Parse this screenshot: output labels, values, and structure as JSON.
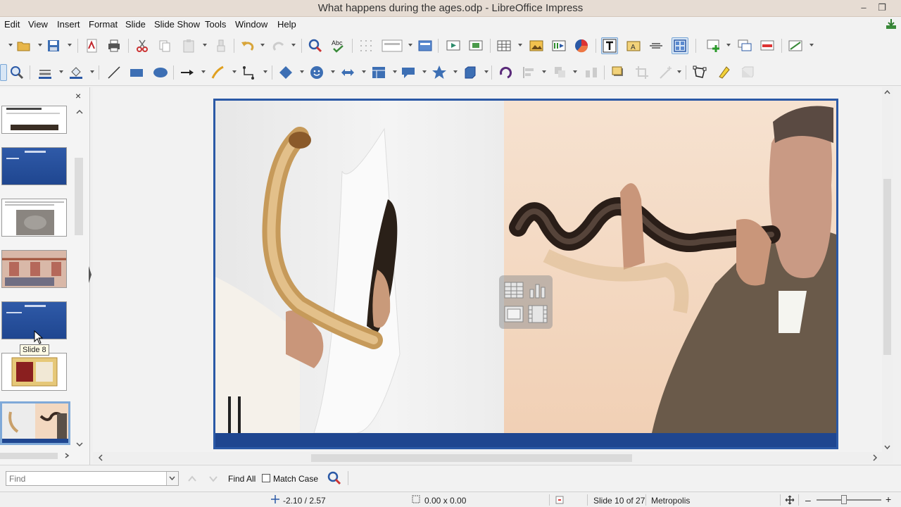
{
  "window": {
    "title": "What happens during the ages.odp - LibreOffice Impress",
    "minimize": "–",
    "restore": "❐"
  },
  "menu": [
    "Edit",
    "View",
    "Insert",
    "Format",
    "Slide",
    "Slide Show",
    "Tools",
    "Window",
    "Help"
  ],
  "slides_panel": {
    "close": "×",
    "tooltip": "Slide 8"
  },
  "findbar": {
    "placeholder": "Find",
    "find_all": "Find All",
    "match_case": "Match Case"
  },
  "statusbar": {
    "position": "-2.10 / 2.57",
    "size": "0.00 x 0.00",
    "slide": "Slide 10 of 27",
    "master": "Metropolis",
    "zoom_minus": "–",
    "zoom_plus": "+"
  },
  "colors": {
    "accent": "#2b59a6",
    "slide_bar": "#1f4690"
  }
}
